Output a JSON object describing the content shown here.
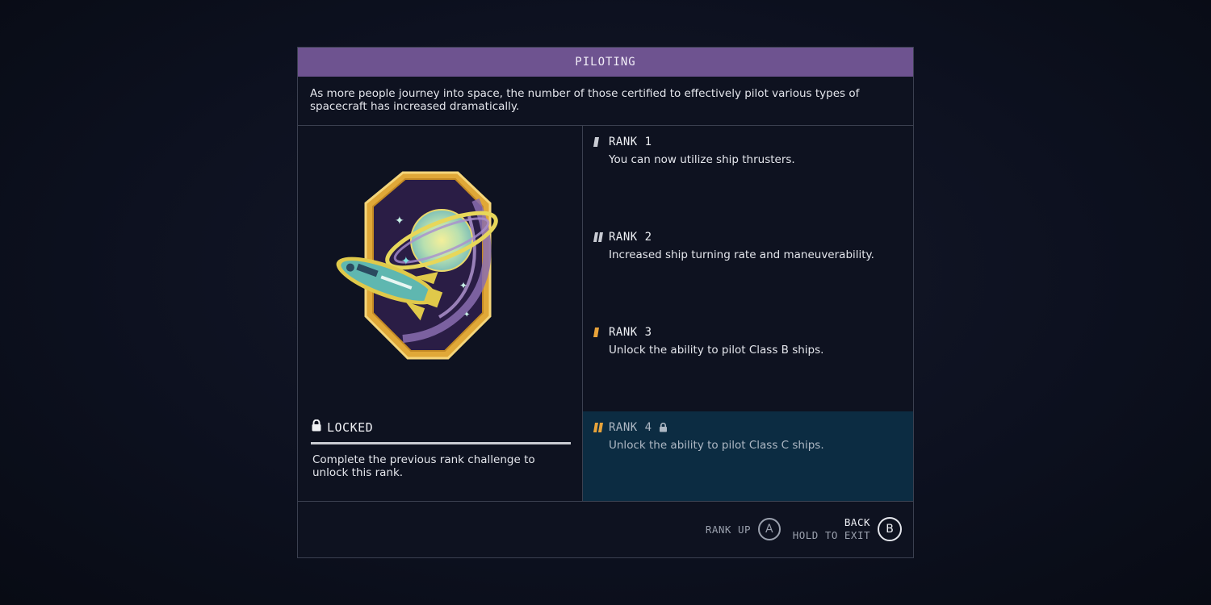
{
  "skill": {
    "title": "PILOTING",
    "description": "As more people journey into space, the number of those certified to effectively pilot various types of spacecraft has increased dramatically.",
    "badge_icon": "shuttle-planet-patch-icon"
  },
  "lock": {
    "status": "LOCKED",
    "description": "Complete the previous rank challenge to unlock this rank."
  },
  "ranks": [
    {
      "label": "RANK 1",
      "description": "You can now utilize ship thrusters.",
      "marker_color": "#c8cbd3"
    },
    {
      "label": "RANK 2",
      "description": "Increased ship turning rate and maneuverability.",
      "marker_color": "#c8cbd3"
    },
    {
      "label": "RANK 3",
      "description": "Unlock the ability to pilot Class B ships.",
      "marker_color": "#e8a33a"
    },
    {
      "label": "RANK 4",
      "description": "Unlock the ability to pilot Class C ships.",
      "marker_color": "#e8a33a",
      "locked": true,
      "selected": true
    }
  ],
  "footer": {
    "rank_up_label": "RANK UP",
    "rank_up_key": "A",
    "back_label": "BACK",
    "exit_label": "HOLD TO EXIT",
    "back_key": "B"
  },
  "colors": {
    "title_bar": "#6e5390",
    "selected_row": "#0c2c42",
    "accent_gold": "#e8a33a"
  }
}
